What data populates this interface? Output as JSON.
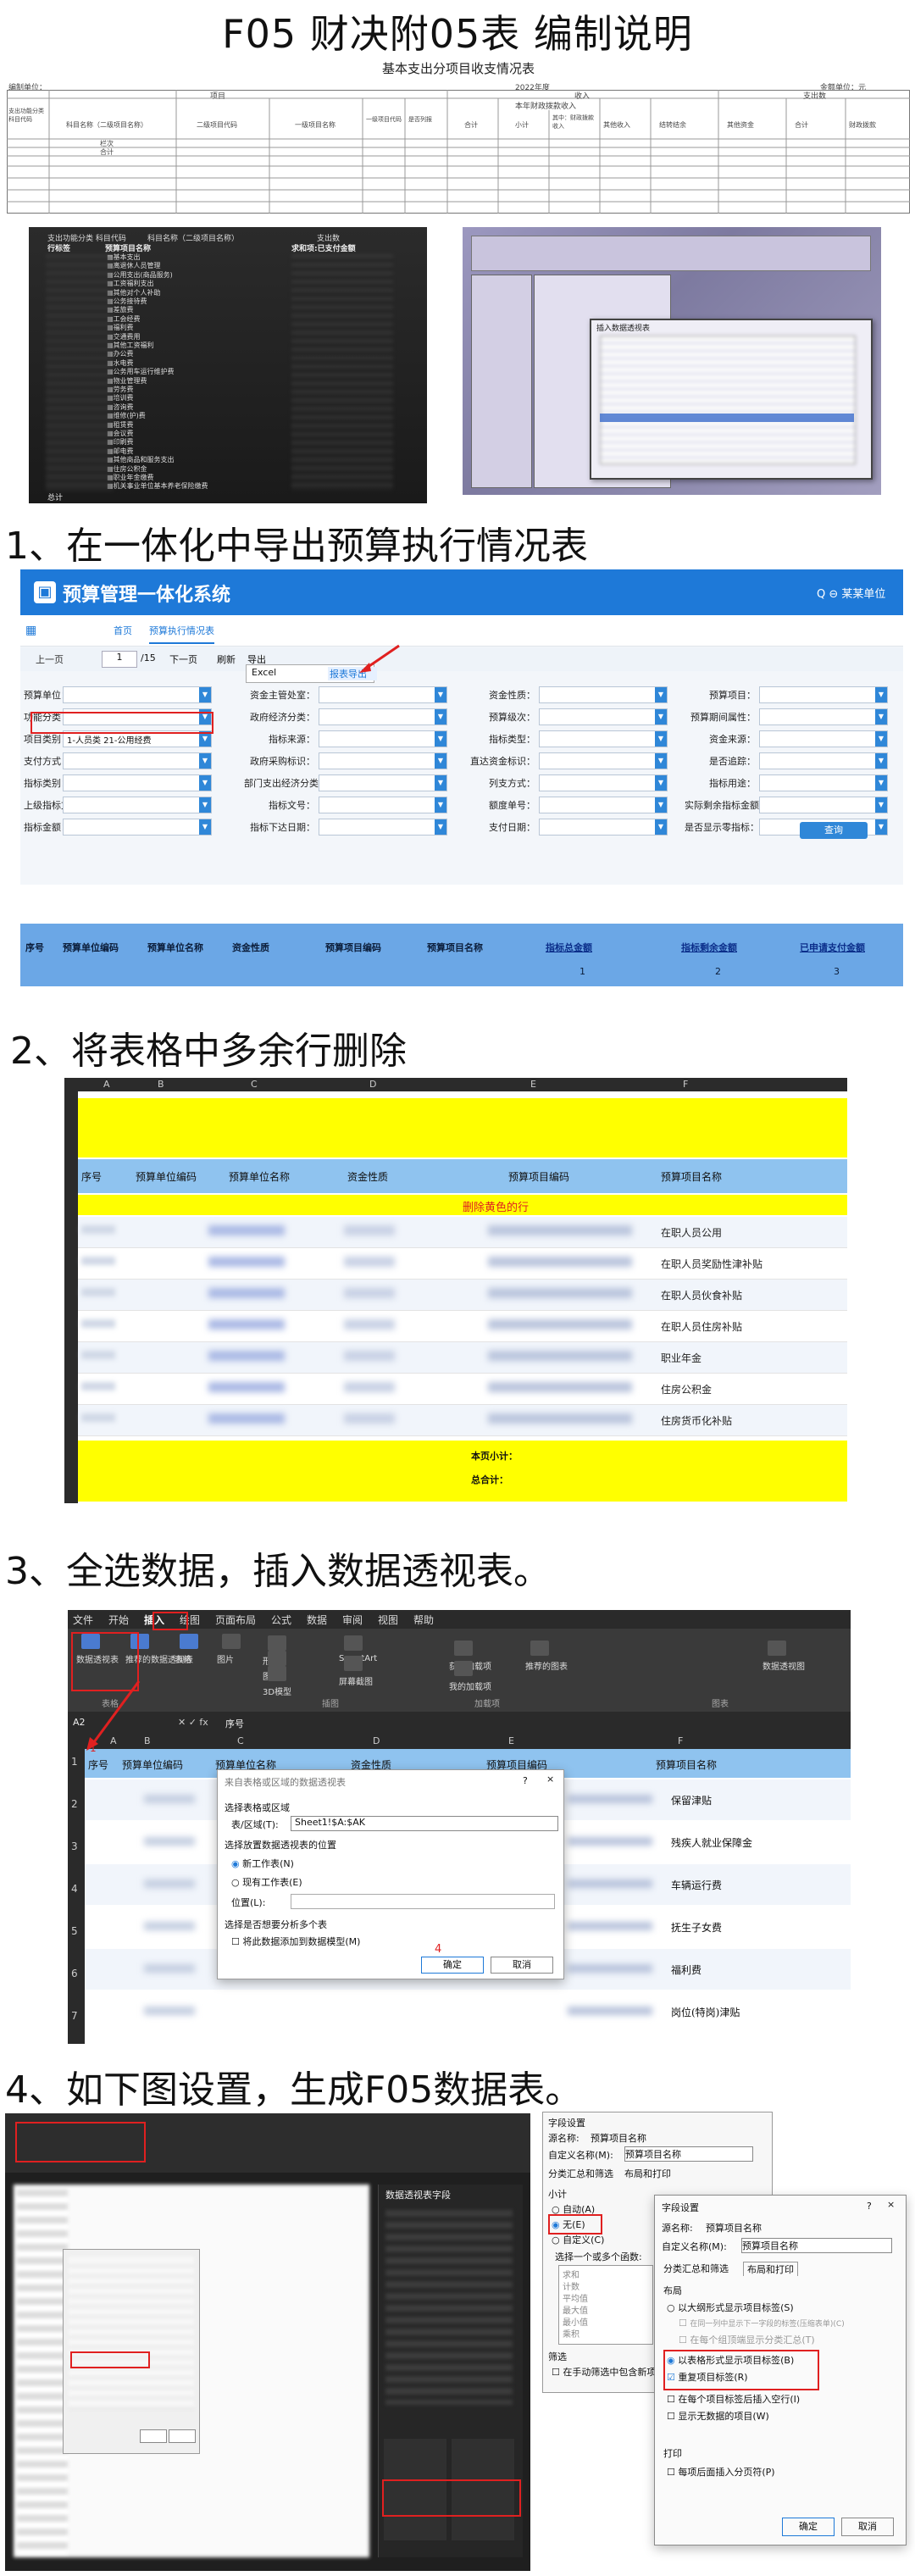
{
  "doc": {
    "title": "F05 财决附05表 编制说明"
  },
  "sample_table": {
    "caption": "基本支出分项目收支情况表",
    "unit_label": "编制单位：",
    "year_label": "2022年度",
    "right_unit": "金额单位：元",
    "col_groups": [
      "项目",
      "收入",
      "本年收入",
      "支出数"
    ],
    "headers": [
      "支出功能分类科目代码",
      "科目名称（二级项目名称）",
      "二级项目代码",
      "一级项目名称",
      "一级项目代码",
      "是否列报",
      "合计",
      "小计",
      "其中：财政拨款收入",
      "其他收入",
      "结转结余",
      "其他资金",
      "合计",
      "财政拨款",
      "其他资金"
    ],
    "subheader": "本年财政拨款收入",
    "row_total": "栏次",
    "row_sum": "合计"
  },
  "shot1": {
    "header_left": "支出功能分类 科目代码",
    "header_mid": "科目名称（二级项目名称）",
    "header_right": "支出数",
    "col_label": "行标签",
    "col_item": "预算项目名称",
    "col_sum": "求和项:已支付金额",
    "items": [
      "■基本支出",
      "■离退休人员管理",
      "■公用支出(商品服务)",
      "■工资福利支出",
      "■其他对个人补助",
      "■公务接待费",
      "■差旅费",
      "■工会经费",
      "■福利费",
      "■交通费用",
      "■其他工资福利",
      "■办公费",
      "■水电费",
      "■公务用车运行维护费",
      "■物业管理费",
      "■劳务费",
      "■培训费",
      "■咨询费",
      "■维修(护)费",
      "■租赁费",
      "■会议费",
      "■印刷费",
      "■邮电费",
      "■其他商品和服务支出",
      "■住房公积金",
      "■职业年金缴费",
      "■机关事业单位基本养老保险缴费"
    ],
    "footer": "总计"
  },
  "shot2": {
    "dialog_title": "插入数据透视表"
  },
  "step1": {
    "heading": "1、在一体化中导出预算执行情况表",
    "app_title": "预算管理一体化系统",
    "top_right": "Q  ⊖ 某某单位",
    "nav_home": "首页",
    "nav_tab": "预算执行情况表",
    "toolbar": {
      "prev": "上一页",
      "page": "1",
      "total": "/15",
      "next": "下一页",
      "refresh": "刷新",
      "export": "导出"
    },
    "menu": {
      "excel": "Excel",
      "submenu": "报表导出"
    },
    "filters": [
      {
        "label": "预算单位：",
        "value": ""
      },
      {
        "label": "资金主管处室：",
        "value": ""
      },
      {
        "label": "资金性质：",
        "value": ""
      },
      {
        "label": "预算项目：",
        "value": ""
      },
      {
        "label": "功能分类：",
        "value": ""
      },
      {
        "label": "政府经济分类：",
        "value": ""
      },
      {
        "label": "预算级次：",
        "value": ""
      },
      {
        "label": "预算期间属性：",
        "value": ""
      },
      {
        "label": "项目类别：",
        "value": "1-人员类  21-公用经费"
      },
      {
        "label": "指标来源：",
        "value": ""
      },
      {
        "label": "指标类型：",
        "value": ""
      },
      {
        "label": "资金来源：",
        "value": ""
      },
      {
        "label": "支付方式：",
        "value": ""
      },
      {
        "label": "政府采购标识：",
        "value": ""
      },
      {
        "label": "直达资金标识：",
        "value": ""
      },
      {
        "label": "是否追踪：",
        "value": ""
      },
      {
        "label": "指标类别：",
        "value": ""
      },
      {
        "label": "部门支出经济分类：",
        "value": ""
      },
      {
        "label": "列支方式：",
        "value": ""
      },
      {
        "label": "指标用途：",
        "value": ""
      },
      {
        "label": "上级指标文号：",
        "value": ""
      },
      {
        "label": "指标文号：",
        "value": ""
      },
      {
        "label": "额度单号：",
        "value": ""
      },
      {
        "label": "实际剩余指标金额：",
        "value": ""
      },
      {
        "label": "指标金额：",
        "value": ""
      },
      {
        "label": "指标下达日期：",
        "value": ""
      },
      {
        "label": "支付日期：",
        "value": ""
      },
      {
        "label": "是否显示零指标：",
        "value": ""
      }
    ],
    "query": "查询",
    "grid_headers": [
      "序号",
      "预算单位编码",
      "预算单位名称",
      "资金性质",
      "预算项目编码",
      "预算项目名称",
      "指标总金额",
      "指标剩余金额",
      "已申请支付金额"
    ],
    "grid_nums": [
      "1",
      "2",
      "3"
    ]
  },
  "step2": {
    "heading": "2、将表格中多余行删除",
    "cols": [
      "A",
      "B",
      "C",
      "D",
      "E",
      "F"
    ],
    "headers": [
      "序号",
      "预算单位编码",
      "预算单位名称",
      "资金性质",
      "预算项目编码",
      "预算项目名称"
    ],
    "note": "删除黄色的行",
    "items": [
      "在职人员公用",
      "在职人员奖励性津补贴",
      "在职人员伙食补贴",
      "在职人员住房补贴",
      "职业年金",
      "住房公积金",
      "住房货币化补贴"
    ],
    "subtotal": "本页小计：",
    "total": "总合计："
  },
  "step3": {
    "heading": "3、全选数据，插入数据透视表。",
    "ribbon_tabs": [
      "文件",
      "开始",
      "插入",
      "绘图",
      "页面布局",
      "公式",
      "数据",
      "审阅",
      "视图",
      "帮助"
    ],
    "ribbon_btns": [
      "数据透视表",
      "推荐的数据透视表",
      "表格",
      "图片",
      "形状",
      "图标",
      "3D模型",
      "SmartArt",
      "屏幕截图",
      "获取加载项",
      "我的加载项",
      "推荐的图表",
      "数据透视图"
    ],
    "groups": [
      "表格",
      "插图",
      "加载项",
      "图表"
    ],
    "cell_ref": "A2",
    "formula": "序号",
    "cols": [
      "A",
      "B",
      "C",
      "D",
      "E",
      "F"
    ],
    "headers": [
      "序号",
      "预算单位编码",
      "预算单位名称",
      "资金性质",
      "预算项目编码",
      "预算项目名称"
    ],
    "items": [
      "保留津贴",
      "残疾人就业保障金",
      "车辆运行费",
      "抚生子女费",
      "福利费",
      "岗位(特岗)津贴"
    ],
    "dialog": {
      "title": "来自表格或区域的数据透视表",
      "q": "?",
      "close": "×",
      "sec1": "选择表格或区域",
      "range_label": "表/区域(T):",
      "range_value": "Sheet1!$A:$AK",
      "sec2": "选择放置数据透视表的位置",
      "opt1": "新工作表(N)",
      "opt2": "现有工作表(E)",
      "pos_label": "位置(L):",
      "sec3": "选择是否想要分析多个表",
      "chk": "将此数据添加到数据模型(M)",
      "ok": "确定",
      "cancel": "取消"
    },
    "markers": [
      "1",
      "2",
      "3",
      "4"
    ]
  },
  "step4": {
    "heading": "4、如下图设置，生成F05数据表。",
    "pivot_pane_title": "数据透视表字段",
    "field_dialog": {
      "title": "字段设置",
      "source_label": "源名称:",
      "source_value": "预算项目名称",
      "custom_label": "自定义名称(M):",
      "custom_value": "预算项目名称",
      "tabs": [
        "分类汇总和筛选",
        "布局和打印"
      ],
      "subtotal": "小计",
      "auto": "自动(A)",
      "none": "无(E)",
      "custom": "自定义(C)",
      "choose": "选择一个或多个函数:",
      "funcs": [
        "求和",
        "计数",
        "平均值",
        "最大值",
        "最小值",
        "乘积"
      ],
      "filter": "筛选",
      "filter_chk": "在手动筛选中包含新项目(N)"
    },
    "field_dialog2": {
      "title": "字段设置",
      "q": "?",
      "close": "×",
      "source_label": "源名称:",
      "source_value": "预算项目名称",
      "custom_label": "自定义名称(M):",
      "custom_value": "预算项目名称",
      "tabs": [
        "分类汇总和筛选",
        "布局和打印"
      ],
      "layout": "布局",
      "opt1": "以大纲形式显示项目标签(S)",
      "opt1a": "在同一列中显示下一字段的标签(压缩表单)(C)",
      "opt1b": "在每个组顶端显示分类汇总(T)",
      "opt2": "以表格形式显示项目标签(B)",
      "opt2a": "重复项目标签(R)",
      "opt3": "在每个项目标签后插入空行(I)",
      "opt4": "显示无数据的项目(W)",
      "print": "打印",
      "print_chk": "每项后面插入分页符(P)",
      "ok": "确定",
      "cancel": "取消"
    }
  }
}
